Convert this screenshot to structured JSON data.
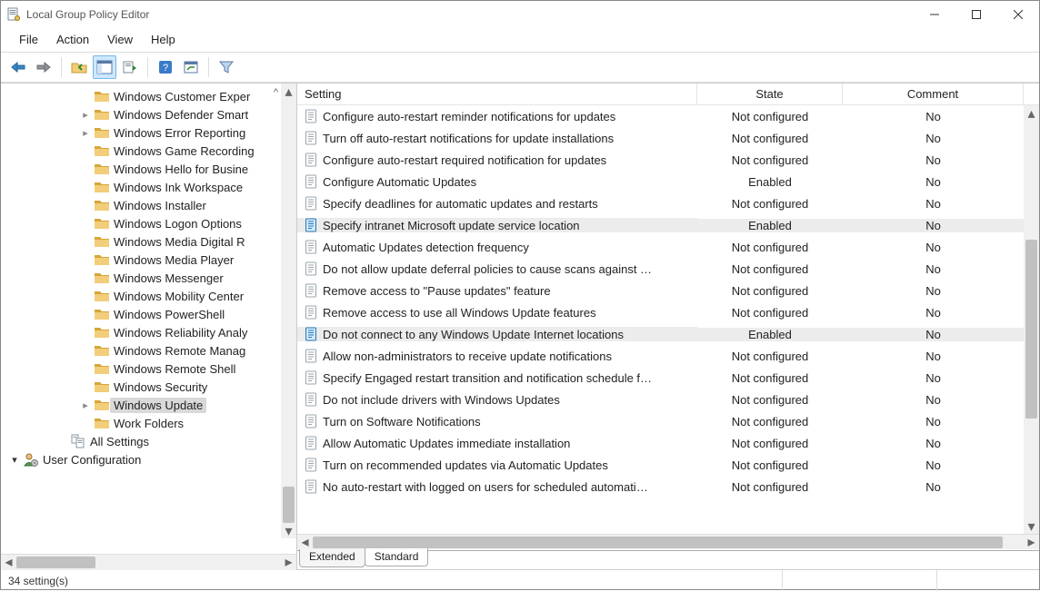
{
  "window": {
    "title": "Local Group Policy Editor"
  },
  "menu": {
    "items": [
      "File",
      "Action",
      "View",
      "Help"
    ]
  },
  "toolbar": {
    "buttons": [
      {
        "name": "back-icon"
      },
      {
        "name": "forward-icon"
      },
      {
        "name": "sep"
      },
      {
        "name": "up-folder-icon"
      },
      {
        "name": "show-hide-tree-icon",
        "active": true
      },
      {
        "name": "export-list-icon"
      },
      {
        "name": "sep"
      },
      {
        "name": "help-icon"
      },
      {
        "name": "policy-settings-icon"
      },
      {
        "name": "sep"
      },
      {
        "name": "filter-icon"
      }
    ]
  },
  "tree": {
    "items": [
      {
        "indent": "b",
        "expander": "",
        "label": "Windows Customer Exper",
        "kind": "folder"
      },
      {
        "indent": "b",
        "expander": ">",
        "label": "Windows Defender Smart",
        "kind": "folder"
      },
      {
        "indent": "b",
        "expander": ">",
        "label": "Windows Error Reporting",
        "kind": "folder"
      },
      {
        "indent": "b",
        "expander": "",
        "label": "Windows Game Recording",
        "kind": "folder"
      },
      {
        "indent": "b",
        "expander": "",
        "label": "Windows Hello for Busine",
        "kind": "folder"
      },
      {
        "indent": "b",
        "expander": "",
        "label": "Windows Ink Workspace",
        "kind": "folder"
      },
      {
        "indent": "b",
        "expander": "",
        "label": "Windows Installer",
        "kind": "folder"
      },
      {
        "indent": "b",
        "expander": "",
        "label": "Windows Logon Options",
        "kind": "folder"
      },
      {
        "indent": "b",
        "expander": "",
        "label": "Windows Media Digital R",
        "kind": "folder"
      },
      {
        "indent": "b",
        "expander": "",
        "label": "Windows Media Player",
        "kind": "folder"
      },
      {
        "indent": "b",
        "expander": "",
        "label": "Windows Messenger",
        "kind": "folder"
      },
      {
        "indent": "b",
        "expander": "",
        "label": "Windows Mobility Center",
        "kind": "folder"
      },
      {
        "indent": "b",
        "expander": "",
        "label": "Windows PowerShell",
        "kind": "folder"
      },
      {
        "indent": "b",
        "expander": "",
        "label": "Windows Reliability Analy",
        "kind": "folder"
      },
      {
        "indent": "b",
        "expander": "",
        "label": "Windows Remote Manag",
        "kind": "folder"
      },
      {
        "indent": "b",
        "expander": "",
        "label": "Windows Remote Shell",
        "kind": "folder"
      },
      {
        "indent": "b",
        "expander": "",
        "label": "Windows Security",
        "kind": "folder"
      },
      {
        "indent": "b",
        "expander": ">",
        "label": "Windows Update",
        "kind": "folder",
        "selected": true
      },
      {
        "indent": "b",
        "expander": "",
        "label": "Work Folders",
        "kind": "folder"
      },
      {
        "indent": "a",
        "expander": "",
        "label": "All Settings",
        "kind": "all-settings"
      },
      {
        "indent": "0",
        "expander": "v",
        "label": "User Configuration",
        "kind": "user-config"
      }
    ]
  },
  "list": {
    "headers": {
      "setting": "Setting",
      "state": "State",
      "comment": "Comment"
    },
    "rows": [
      {
        "setting": "Configure auto-restart reminder notifications for updates",
        "state": "Not configured",
        "comment": "No"
      },
      {
        "setting": "Turn off auto-restart notifications for update installations",
        "state": "Not configured",
        "comment": "No"
      },
      {
        "setting": "Configure auto-restart required notification for updates",
        "state": "Not configured",
        "comment": "No"
      },
      {
        "setting": "Configure Automatic Updates",
        "state": "Enabled",
        "comment": "No",
        "enabled": true
      },
      {
        "setting": "Specify deadlines for automatic updates and restarts",
        "state": "Not configured",
        "comment": "No"
      },
      {
        "setting": "Specify intranet Microsoft update service location",
        "state": "Enabled",
        "comment": "No",
        "enabled": true,
        "highlight": true
      },
      {
        "setting": "Automatic Updates detection frequency",
        "state": "Not configured",
        "comment": "No"
      },
      {
        "setting": "Do not allow update deferral policies to cause scans against …",
        "state": "Not configured",
        "comment": "No"
      },
      {
        "setting": "Remove access to \"Pause updates\" feature",
        "state": "Not configured",
        "comment": "No"
      },
      {
        "setting": "Remove access to use all Windows Update features",
        "state": "Not configured",
        "comment": "No"
      },
      {
        "setting": "Do not connect to any Windows Update Internet locations",
        "state": "Enabled",
        "comment": "No",
        "enabled": true,
        "highlight": true
      },
      {
        "setting": "Allow non-administrators to receive update notifications",
        "state": "Not configured",
        "comment": "No"
      },
      {
        "setting": "Specify Engaged restart transition and notification schedule f…",
        "state": "Not configured",
        "comment": "No"
      },
      {
        "setting": "Do not include drivers with Windows Updates",
        "state": "Not configured",
        "comment": "No"
      },
      {
        "setting": "Turn on Software Notifications",
        "state": "Not configured",
        "comment": "No"
      },
      {
        "setting": "Allow Automatic Updates immediate installation",
        "state": "Not configured",
        "comment": "No"
      },
      {
        "setting": "Turn on recommended updates via Automatic Updates",
        "state": "Not configured",
        "comment": "No"
      },
      {
        "setting": "No auto-restart with logged on users for scheduled automati…",
        "state": "Not configured",
        "comment": "No"
      }
    ]
  },
  "tabs": {
    "items": [
      "Extended",
      "Standard"
    ],
    "active_index": 1
  },
  "status": {
    "text": "34 setting(s)"
  }
}
